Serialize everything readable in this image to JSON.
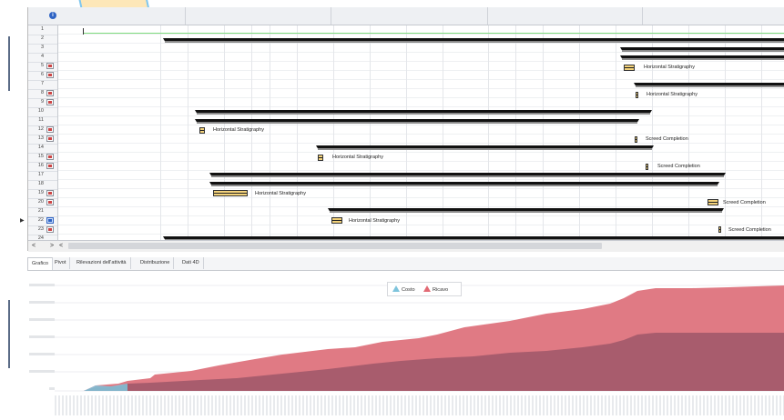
{
  "header": {
    "info_icon": "info-icon"
  },
  "rows": [
    {
      "num": "1",
      "icon": false
    },
    {
      "num": "2",
      "icon": false
    },
    {
      "num": "3",
      "icon": false
    },
    {
      "num": "4",
      "icon": false
    },
    {
      "num": "5",
      "icon": true
    },
    {
      "num": "6",
      "icon": true
    },
    {
      "num": "7",
      "icon": false
    },
    {
      "num": "8",
      "icon": true
    },
    {
      "num": "9",
      "icon": true
    },
    {
      "num": "10",
      "icon": false
    },
    {
      "num": "11",
      "icon": false
    },
    {
      "num": "12",
      "icon": true
    },
    {
      "num": "13",
      "icon": true
    },
    {
      "num": "14",
      "icon": false
    },
    {
      "num": "15",
      "icon": true
    },
    {
      "num": "16",
      "icon": true
    },
    {
      "num": "17",
      "icon": false
    },
    {
      "num": "18",
      "icon": false
    },
    {
      "num": "19",
      "icon": true
    },
    {
      "num": "20",
      "icon": true
    },
    {
      "num": "21",
      "icon": false
    },
    {
      "num": "22",
      "icon": true,
      "selected": true
    },
    {
      "num": "23",
      "icon": true
    },
    {
      "num": "24",
      "icon": false
    }
  ],
  "gantt_labels": {
    "horizontal_stratigraphy": "Horizontal Stratigraphy",
    "screed_completion": "Screed Completion"
  },
  "scroll": {
    "left_arrow": "<",
    "right_arrow": ">"
  },
  "tabs": [
    "Grafico",
    "Pivot",
    "Rilevazioni dell'attività",
    "Distribuzione",
    "Dati 4D"
  ],
  "legend": {
    "costo": "Costo",
    "ricavo": "Ricavo"
  },
  "colors": {
    "costo": "#7ec4dc",
    "ricavo": "#e26a74",
    "ricavo_dark": "#a85c6d",
    "selected": "#2f64c4"
  }
}
